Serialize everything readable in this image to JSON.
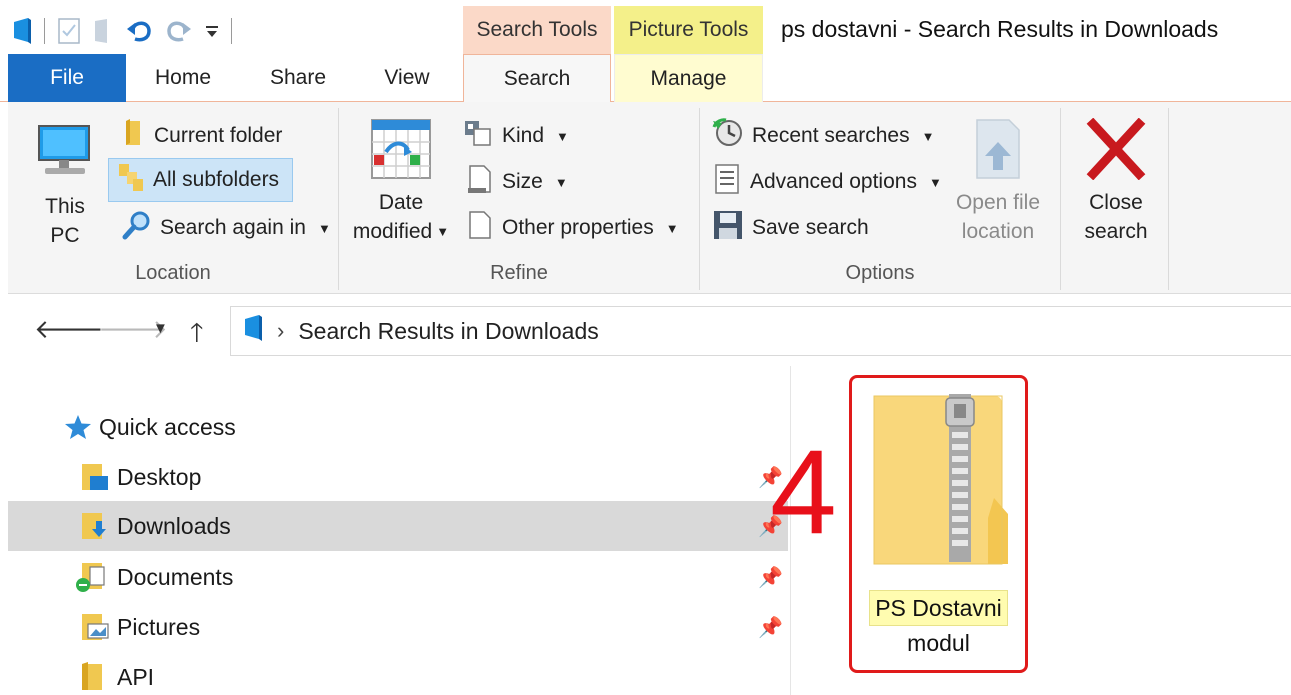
{
  "window": {
    "title": "ps dostavni - Search Results in Downloads",
    "context_tabs": {
      "search_tools": "Search Tools",
      "picture_tools": "Picture Tools"
    }
  },
  "tabs": {
    "file": "File",
    "home": "Home",
    "share": "Share",
    "view": "View",
    "search": "Search",
    "manage": "Manage"
  },
  "ribbon": {
    "location": {
      "label": "Location",
      "this_pc_line1": "This",
      "this_pc_line2": "PC",
      "current_folder": "Current folder",
      "all_subfolders": "All subfolders",
      "search_again_in": "Search again in"
    },
    "refine": {
      "label": "Refine",
      "date_modified_line1": "Date",
      "date_modified_line2": "modified",
      "kind": "Kind",
      "size": "Size",
      "other_properties": "Other properties"
    },
    "options": {
      "label": "Options",
      "recent_searches": "Recent searches",
      "advanced_options": "Advanced options",
      "save_search": "Save search",
      "open_file_location_line1": "Open file",
      "open_file_location_line2": "location"
    },
    "close": {
      "line1": "Close",
      "line2": "search"
    }
  },
  "address": {
    "path": "Search Results in Downloads"
  },
  "nav_pane": {
    "quick_access": "Quick access",
    "items": [
      {
        "label": "Desktop"
      },
      {
        "label": "Downloads"
      },
      {
        "label": "Documents"
      },
      {
        "label": "Pictures"
      },
      {
        "label": "API"
      }
    ]
  },
  "content": {
    "annotation": "4",
    "file": {
      "name_line1": "PS Dostavni",
      "name_line2": "modul"
    }
  },
  "colors": {
    "file_tab": "#1a6dc4",
    "search_tools": "#fbd9c8",
    "picture_tools": "#f4f08a",
    "annotation": "#e8101a"
  }
}
